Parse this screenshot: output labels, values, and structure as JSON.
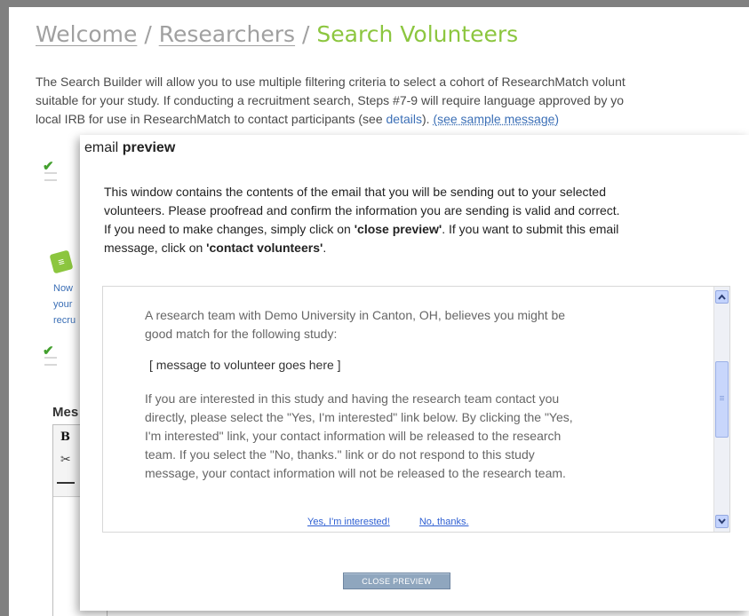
{
  "breadcrumb": {
    "items": [
      "Welcome",
      "Researchers"
    ],
    "separator": "/",
    "current": "Search Volunteers"
  },
  "intro": {
    "line1": "The Search Builder will allow you to use multiple filtering criteria to select a cohort of ResearchMatch volunt",
    "line2": "suitable for your study. If conducting a recruitment search, Steps #7-9 will require language approved by yo",
    "line3_prefix": "local IRB for use in ResearchMatch to contact participants (see ",
    "details_link": "details",
    "line3_mid": "). ",
    "sample_link": "(see sample message)"
  },
  "background": {
    "side_text": [
      "Now",
      "your",
      "recru"
    ],
    "message_heading": "Mes",
    "editor_bold": "B",
    "editor_cut": "✂"
  },
  "modal": {
    "title_prefix": "email ",
    "title_bold": "preview",
    "description": {
      "line1": "This window contains the contents of the email that you will be sending out to your selected",
      "line2": "volunteers. Please proofread and confirm the information you are sending is valid and correct.",
      "line3_prefix": "If you need to make changes, simply click on ",
      "close_ref": "'close preview'",
      "line3_suffix": ". If you want to submit this email",
      "line4_prefix": "message, click on ",
      "contact_ref": "'contact volunteers'",
      "line4_suffix": "."
    },
    "message": {
      "intro_line1": "A research team with Demo University in Canton, OH, believes you might be",
      "intro_line2": "good match for the following study:",
      "placeholder": "[ message to volunteer goes here ]",
      "body_lines": [
        "If you are interested in this study and having the research team contact you",
        "directly, please select the \"Yes, I'm interested\" link below. By clicking the \"Yes,",
        "I'm interested\" link, your contact information will be released to the research",
        "team. If you select the \"No, thanks.\" link or do not respond to this study",
        "message, your contact information will not be released to the research team."
      ],
      "yes_link": "Yes, I'm interested!",
      "no_link": "No, thanks."
    },
    "close_button": "CLOSE PREVIEW"
  },
  "colors": {
    "accent_green": "#8cc63f",
    "link_blue": "#3b6fb6",
    "button_slate": "#8fa6be"
  }
}
